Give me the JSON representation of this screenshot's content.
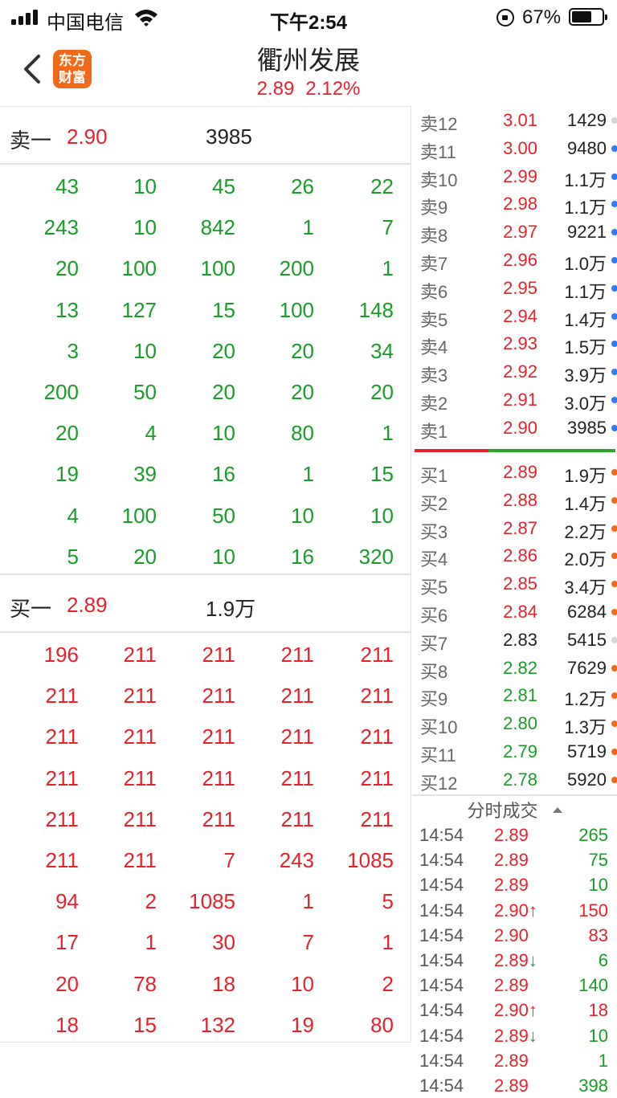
{
  "status_bar": {
    "carrier": "中国电信",
    "time": "下午2:54",
    "battery_pct": "67%",
    "battery_level": 0.67
  },
  "header": {
    "logo_line1": "东方",
    "logo_line2": "财富",
    "stock_name": "衢州发展",
    "price": "2.89",
    "change_pct": "2.12%"
  },
  "sell1": {
    "label": "卖一",
    "price": "2.90",
    "volume": "3985"
  },
  "sell_queue": [
    [
      "43",
      "10",
      "45",
      "26",
      "22"
    ],
    [
      "243",
      "10",
      "842",
      "1",
      "7"
    ],
    [
      "20",
      "100",
      "100",
      "200",
      "1"
    ],
    [
      "13",
      "127",
      "15",
      "100",
      "148"
    ],
    [
      "3",
      "10",
      "20",
      "20",
      "34"
    ],
    [
      "200",
      "50",
      "20",
      "20",
      "20"
    ],
    [
      "20",
      "4",
      "10",
      "80",
      "1"
    ],
    [
      "19",
      "39",
      "16",
      "1",
      "15"
    ],
    [
      "4",
      "100",
      "50",
      "10",
      "10"
    ],
    [
      "5",
      "20",
      "10",
      "16",
      "320"
    ]
  ],
  "buy1": {
    "label": "买一",
    "price": "2.89",
    "volume": "1.9万"
  },
  "buy_queue": [
    [
      "196",
      "211",
      "211",
      "211",
      "211"
    ],
    [
      "211",
      "211",
      "211",
      "211",
      "211"
    ],
    [
      "211",
      "211",
      "211",
      "211",
      "211"
    ],
    [
      "211",
      "211",
      "211",
      "211",
      "211"
    ],
    [
      "211",
      "211",
      "211",
      "211",
      "211"
    ],
    [
      "211",
      "211",
      "7",
      "243",
      "1085"
    ],
    [
      "94",
      "2",
      "1085",
      "1",
      "5"
    ],
    [
      "17",
      "1",
      "30",
      "7",
      "1"
    ],
    [
      "20",
      "78",
      "18",
      "10",
      "2"
    ],
    [
      "18",
      "15",
      "132",
      "19",
      "80"
    ]
  ],
  "asks": [
    {
      "label": "卖12",
      "price": "3.01",
      "volume": "1429",
      "color": "red",
      "dot": "gray"
    },
    {
      "label": "卖11",
      "price": "3.00",
      "volume": "9480",
      "color": "red",
      "dot": "blue"
    },
    {
      "label": "卖10",
      "price": "2.99",
      "volume": "1.1万",
      "color": "red",
      "dot": "blue"
    },
    {
      "label": "卖9",
      "price": "2.98",
      "volume": "1.1万",
      "color": "red",
      "dot": "blue"
    },
    {
      "label": "卖8",
      "price": "2.97",
      "volume": "9221",
      "color": "red",
      "dot": "blue"
    },
    {
      "label": "卖7",
      "price": "2.96",
      "volume": "1.0万",
      "color": "red",
      "dot": "blue"
    },
    {
      "label": "卖6",
      "price": "2.95",
      "volume": "1.1万",
      "color": "red",
      "dot": "blue"
    },
    {
      "label": "卖5",
      "price": "2.94",
      "volume": "1.4万",
      "color": "red",
      "dot": "blue"
    },
    {
      "label": "卖4",
      "price": "2.93",
      "volume": "1.5万",
      "color": "red",
      "dot": "blue"
    },
    {
      "label": "卖3",
      "price": "2.92",
      "volume": "3.9万",
      "color": "red",
      "dot": "blue"
    },
    {
      "label": "卖2",
      "price": "2.91",
      "volume": "3.0万",
      "color": "red",
      "dot": "blue"
    },
    {
      "label": "卖1",
      "price": "2.90",
      "volume": "3985",
      "color": "red",
      "dot": "blue"
    }
  ],
  "bids": [
    {
      "label": "买1",
      "price": "2.89",
      "volume": "1.9万",
      "color": "red",
      "dot": "orange"
    },
    {
      "label": "买2",
      "price": "2.88",
      "volume": "1.4万",
      "color": "red",
      "dot": "orange"
    },
    {
      "label": "买3",
      "price": "2.87",
      "volume": "2.2万",
      "color": "red",
      "dot": "orange"
    },
    {
      "label": "买4",
      "price": "2.86",
      "volume": "2.0万",
      "color": "red",
      "dot": "orange"
    },
    {
      "label": "买5",
      "price": "2.85",
      "volume": "3.4万",
      "color": "red",
      "dot": "orange"
    },
    {
      "label": "买6",
      "price": "2.84",
      "volume": "6284",
      "color": "red",
      "dot": "orange"
    },
    {
      "label": "买7",
      "price": "2.83",
      "volume": "5415",
      "color": "dark",
      "dot": "gray"
    },
    {
      "label": "买8",
      "price": "2.82",
      "volume": "7629",
      "color": "green",
      "dot": "orange"
    },
    {
      "label": "买9",
      "price": "2.81",
      "volume": "1.2万",
      "color": "green",
      "dot": "orange"
    },
    {
      "label": "买10",
      "price": "2.80",
      "volume": "1.3万",
      "color": "green",
      "dot": "orange"
    },
    {
      "label": "买11",
      "price": "2.79",
      "volume": "5719",
      "color": "green",
      "dot": "orange"
    },
    {
      "label": "买12",
      "price": "2.78",
      "volume": "5920",
      "color": "green",
      "dot": "orange"
    }
  ],
  "ticks_title": "分时成交",
  "ticks": [
    {
      "time": "14:54",
      "price": "2.89",
      "volume": "265",
      "vol_color": "green"
    },
    {
      "time": "14:54",
      "price": "2.89",
      "volume": "75",
      "vol_color": "green"
    },
    {
      "time": "14:54",
      "price": "2.89",
      "volume": "10",
      "vol_color": "green"
    },
    {
      "time": "14:54",
      "price": "2.90↑",
      "volume": "150",
      "vol_color": "red"
    },
    {
      "time": "14:54",
      "price": "2.90",
      "volume": "83",
      "vol_color": "red"
    },
    {
      "time": "14:54",
      "price": "2.89↓",
      "volume": "6",
      "vol_color": "green"
    },
    {
      "time": "14:54",
      "price": "2.89",
      "volume": "140",
      "vol_color": "green"
    },
    {
      "time": "14:54",
      "price": "2.90↑",
      "volume": "18",
      "vol_color": "red"
    },
    {
      "time": "14:54",
      "price": "2.89↓",
      "volume": "10",
      "vol_color": "green"
    },
    {
      "time": "14:54",
      "price": "2.89",
      "volume": "1",
      "vol_color": "green"
    },
    {
      "time": "14:54",
      "price": "2.89",
      "volume": "398",
      "vol_color": "green"
    }
  ]
}
